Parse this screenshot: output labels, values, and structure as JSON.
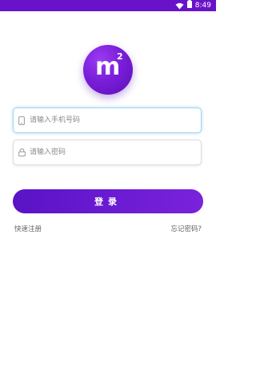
{
  "status_bar": {
    "time": "8:49",
    "wifi_icon": "wifi-icon",
    "battery_icon": "battery-icon",
    "color": "#6a12c9"
  },
  "logo": {
    "letter": "m",
    "superscript": "2"
  },
  "phone_field": {
    "icon": "phone-icon",
    "placeholder": "请输入手机号码",
    "value": ""
  },
  "password_field": {
    "icon": "lock-icon",
    "placeholder": "请输入密码",
    "value": ""
  },
  "login_button": {
    "label": "登录",
    "color_start": "#5a13c6",
    "color_end": "#7a22dc"
  },
  "links": {
    "register": "快速注册",
    "forgot_password": "忘记密码?"
  }
}
